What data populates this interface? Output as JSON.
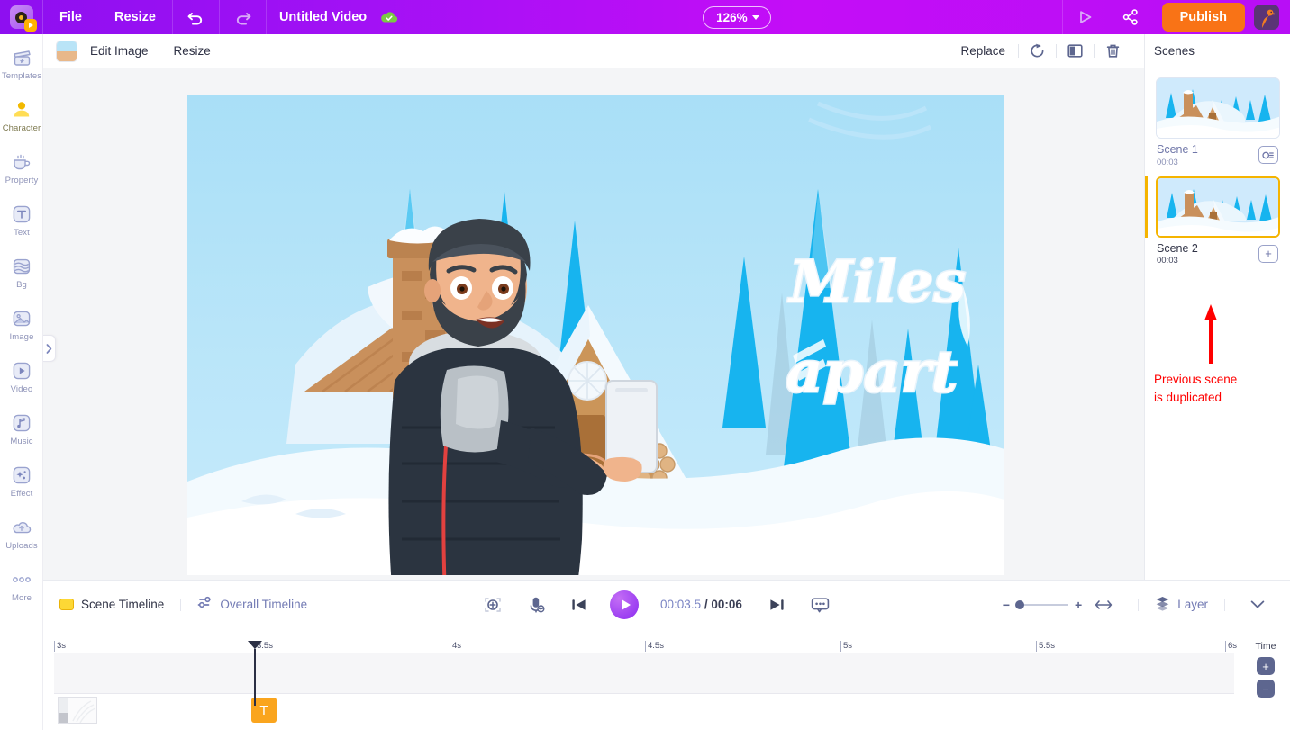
{
  "topbar": {
    "logo": "app-logo",
    "menu_file": "File",
    "menu_resize": "Resize",
    "undo_icon": "undo-icon",
    "redo_icon": "redo-icon",
    "project_title": "Untitled Video",
    "cloud_icon": "cloud-saved-icon",
    "zoom_level": "126%",
    "preview_icon": "preview-play-icon",
    "share_icon": "share-icon",
    "publish_label": "Publish",
    "avatar": "user-avatar"
  },
  "sidebar": {
    "items": [
      {
        "label": "Templates",
        "icon": "templates-icon",
        "active": false
      },
      {
        "label": "Character",
        "icon": "character-icon",
        "active": true
      },
      {
        "label": "Property",
        "icon": "property-icon",
        "active": false
      },
      {
        "label": "Text",
        "icon": "text-icon",
        "active": false
      },
      {
        "label": "Bg",
        "icon": "background-icon",
        "active": false
      },
      {
        "label": "Image",
        "icon": "image-icon",
        "active": false
      },
      {
        "label": "Video",
        "icon": "video-icon",
        "active": false
      },
      {
        "label": "Music",
        "icon": "music-icon",
        "active": false
      },
      {
        "label": "Effect",
        "icon": "effect-icon",
        "active": false
      },
      {
        "label": "Uploads",
        "icon": "uploads-cloud-icon",
        "active": false
      },
      {
        "label": "More",
        "icon": "more-dots-icon",
        "active": false
      }
    ]
  },
  "subbar": {
    "selection_thumb": "selected-image-thumbnail",
    "edit_image": "Edit Image",
    "resize": "Resize",
    "replace": "Replace",
    "rotate_icon": "rotate-icon",
    "flip_icon": "flip-horizontal-icon",
    "delete_icon": "trash-icon"
  },
  "canvas": {
    "text_line1": "Miles",
    "text_line2": "apart",
    "scene_description": "winter-snow-cabin-scene-with-bearded-character-holding-phone"
  },
  "scenes_panel": {
    "title": "Scenes",
    "scenes": [
      {
        "name": "Scene 1",
        "duration": "00:03",
        "selected": false,
        "action_icon": "link-transition-icon",
        "action_label": "∞"
      },
      {
        "name": "Scene 2",
        "duration": "00:03",
        "selected": true,
        "action_icon": "add-scene-icon",
        "action_label": "+"
      }
    ],
    "annotation_line1": "Previous scene",
    "annotation_line2": "is duplicated",
    "annotation_color": "#ff0000"
  },
  "timeline": {
    "scene_timeline_label": "Scene Timeline",
    "overall_timeline_label": "Overall Timeline",
    "focus_icon": "focus-target-icon",
    "mic_icon": "microphone-record-icon",
    "prev_icon": "previous-frame-icon",
    "play_icon": "play-icon",
    "next_icon": "next-frame-icon",
    "caption_icon": "subtitle-icon",
    "current_time": "00:03.5",
    "separator": "/",
    "total_time": "00:06",
    "zoom_minus": "−",
    "zoom_plus": "+",
    "fit_icon": "fit-width-icon",
    "layer_icon": "layers-icon",
    "layer_label": "Layer",
    "chevron_icon": "chevron-down-icon",
    "ruler_ticks": [
      "3s",
      "3.5s",
      "4s",
      "4.5s",
      "5s",
      "5.5s",
      "6s"
    ],
    "playhead_time": "3.5s",
    "text_clip_label": "T",
    "time_label": "Time",
    "time_plus": "+",
    "time_minus": "−"
  },
  "colors": {
    "brand_purple": "#a211f5",
    "accent_orange": "#f97316",
    "selected_gold": "#f5b400",
    "annotation_red": "#ff0000",
    "text_clip_orange": "#faa51e"
  }
}
